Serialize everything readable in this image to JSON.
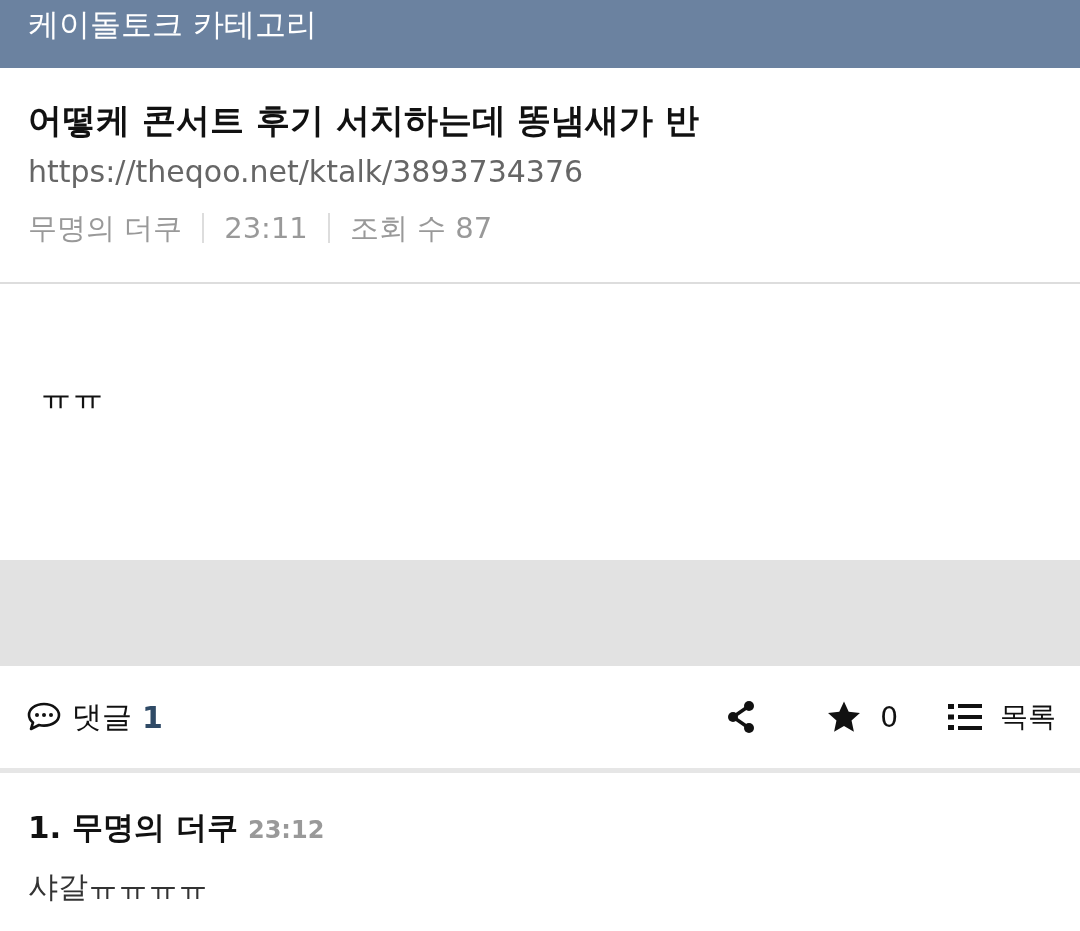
{
  "header": {
    "title": "케이돌토크 카테고리"
  },
  "post": {
    "title": "어떻케 콘서트 후기 서치하는데 똥냄새가 반",
    "url": "https://theqoo.net/ktalk/3893734376",
    "author": "무명의 더쿠",
    "time": "23:11",
    "views": "조회 수 87",
    "body": "ㅠㅠ"
  },
  "actions": {
    "comments_label": "댓글",
    "comments_count": "1",
    "stars": "0",
    "list_label": "목록"
  },
  "comments": [
    {
      "number": "1.",
      "author": "무명의 더쿠",
      "time": "23:12",
      "text": "샤갈ㅠㅠㅠㅠ"
    }
  ]
}
